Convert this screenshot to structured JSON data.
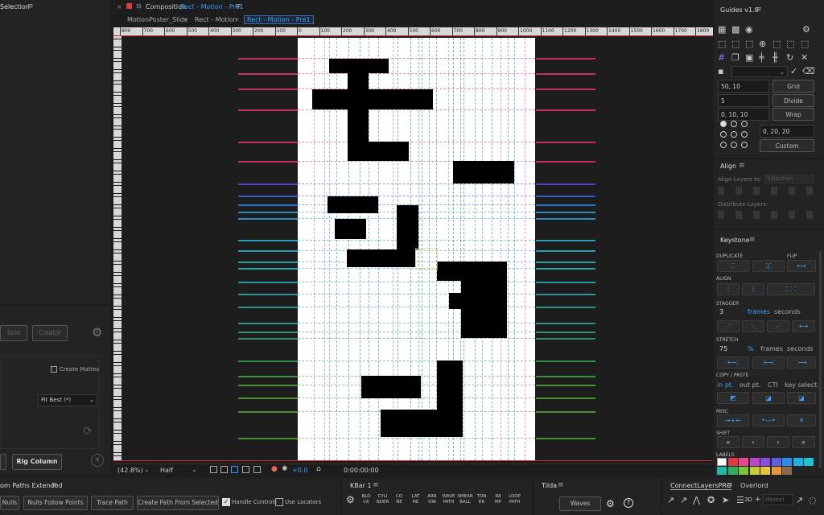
{
  "left_panel": {
    "title": "Selection",
    "grid_label": "Grid",
    "creator_label": "Creator",
    "create_mattes": "Create Mattes",
    "fit_select": "Fit Best (*)",
    "rig_column": "Rig Column"
  },
  "composition": {
    "panel_title": "Composition",
    "comp_name": "Rect - Motion - Pre1",
    "breadcrumbs": [
      "MotionPoster_Slide",
      "Rect - Motion",
      "Rect - Motion - Pre1"
    ],
    "ruler_labels": [
      "800",
      "700",
      "600",
      "500",
      "400",
      "300",
      "200",
      "100",
      "0",
      "100",
      "200",
      "300",
      "400",
      "500",
      "600",
      "700",
      "800",
      "900",
      "1000",
      "1100",
      "1200",
      "1300",
      "1400",
      "1500",
      "1600",
      "1700",
      "1800"
    ],
    "zoom": "(42.8%)",
    "resolution": "Half",
    "exposure": "+0.0",
    "timecode": "0:00:00:00"
  },
  "guides": {
    "title": "Guides v1.0",
    "rows": [
      {
        "value": "50, 10",
        "button": "Grid"
      },
      {
        "value": "5",
        "button": "Divide"
      },
      {
        "value": "0, 10, 10",
        "button": "Wrap"
      }
    ],
    "custom_value": "0, 20, 20",
    "custom_button": "Custom"
  },
  "align": {
    "title": "Align",
    "align_to_label": "Align Layers to:",
    "align_to_value": "Selection",
    "distribute_label": "Distribute Layers:"
  },
  "keystone": {
    "title": "Keystone",
    "duplicate": "DUPLICATE",
    "flip": "FLIP",
    "align": "ALIGN",
    "stagger": "STAGGER",
    "stagger_value": "3",
    "frames": "frames",
    "seconds": "seconds",
    "stretch": "STRETCH",
    "stretch_value": "75",
    "percent": "%",
    "copy_paste": "COPY / PASTE",
    "in_pt": "in pt.",
    "out_pt": "out pt.",
    "cti": "CTI",
    "key_select": "key select.",
    "misc": "MISC",
    "shift": "SHIFT",
    "labels": "LABELS",
    "label_colors": [
      "#ffffff",
      "#e23b3b",
      "#e8468f",
      "#c046c8",
      "#8a4be0",
      "#5b5fe0",
      "#2e8de8",
      "#1fb0e6",
      "#1cc2d8",
      "#22b7a6",
      "#2fae5f",
      "#7ec43a",
      "#c4cf38",
      "#e8c43a",
      "#e8943a",
      "#8a6a4e"
    ]
  },
  "bottom_panels": {
    "paths_title": "om Paths Extended",
    "nulls": "Nulls",
    "nulls_follow_points": "Nulls Follow Points",
    "trace_path": "Trace Path",
    "create_path_from_selected": "Create Path From Selected",
    "handle_controls": "Handle Controls",
    "use_locators": "Use Locators",
    "kbar_title": "KBar 1",
    "kbar_buttons": [
      [
        "BLO",
        "CK"
      ],
      [
        "CYLI",
        "NDER"
      ],
      [
        "CO",
        "NE"
      ],
      [
        "LAT",
        "HE"
      ],
      [
        "ARR",
        "OW"
      ],
      [
        "WAVE",
        "PATH"
      ],
      [
        "SMEAR",
        "BALL"
      ],
      [
        "TON",
        "ER"
      ],
      [
        "RA",
        "MP"
      ],
      [
        "LOOP",
        "PATH"
      ]
    ],
    "tilda_title": "Tilda",
    "waves": "Waves",
    "connect_title": "ConnectLayersPRO",
    "overlord_title": "Overlord",
    "none_label": "(None)"
  }
}
